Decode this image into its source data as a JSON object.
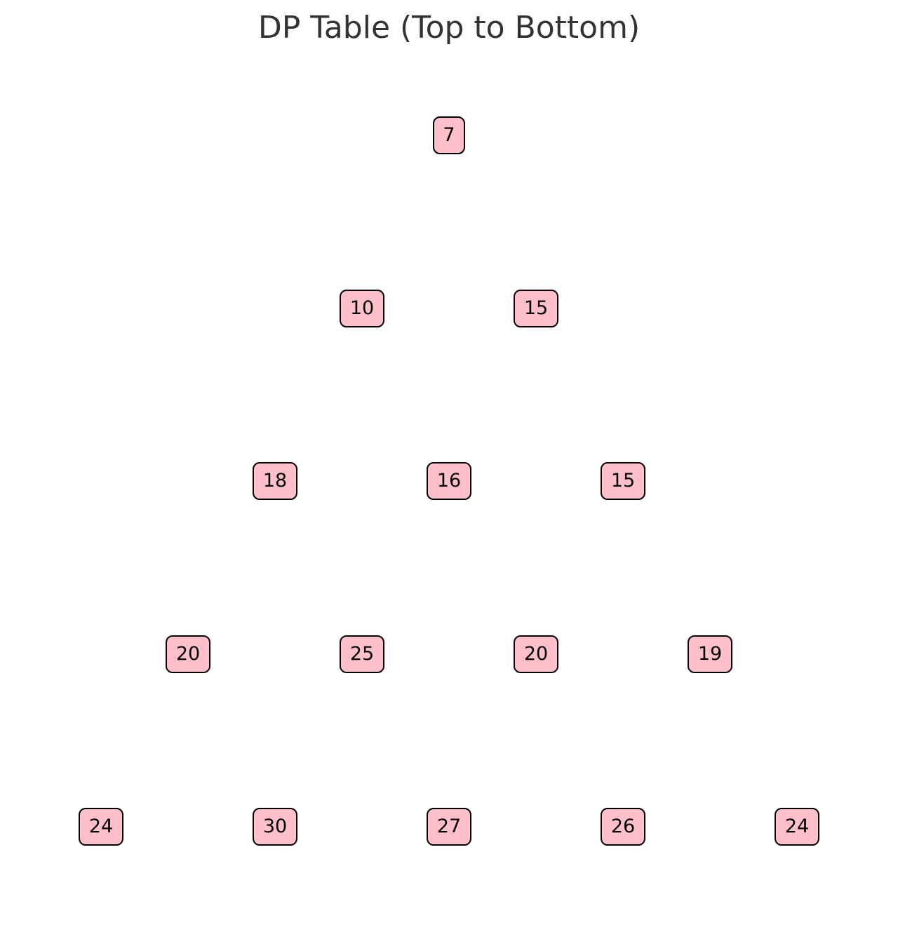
{
  "title": "DP Table (Top to Bottom)",
  "colors": {
    "cell_fill": "#ffc0cb",
    "cell_border": "#000000",
    "title_text": "#333333"
  },
  "rows": [
    [
      7
    ],
    [
      10,
      15
    ],
    [
      18,
      16,
      15
    ],
    [
      20,
      25,
      20,
      19
    ],
    [
      24,
      30,
      27,
      26,
      24
    ]
  ]
}
